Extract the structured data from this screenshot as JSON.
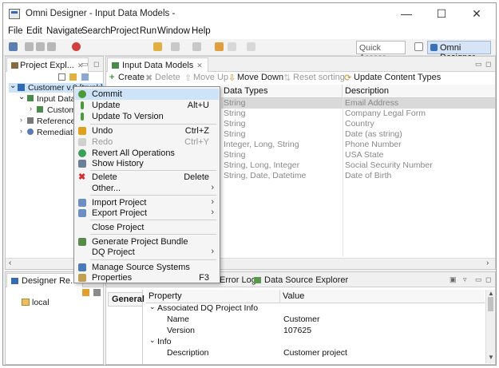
{
  "window": {
    "title": "Omni Designer - Input Data Models -",
    "minimize": "—",
    "maximize": "☐",
    "close": "✕"
  },
  "menubar": [
    "File",
    "Edit",
    "Navigate",
    "Search",
    "Project",
    "Run",
    "Window",
    "Help"
  ],
  "toolbar": {
    "quick_access": "Quick Access",
    "perspective": "Omni Designer"
  },
  "project_explorer": {
    "tab": "Project Expl...",
    "tree": [
      {
        "label": "Customer v.0 [trunk]",
        "level": 0
      },
      {
        "label": "Input Data",
        "level": 1
      },
      {
        "label": "Custom",
        "level": 2
      },
      {
        "label": "Reference",
        "level": 1
      },
      {
        "label": "Remediati",
        "level": 1
      }
    ]
  },
  "designer_repo": {
    "tab": "Designer Re...",
    "item": "local"
  },
  "editor": {
    "tab": "Input Data Models",
    "actions": {
      "create": "Create",
      "delete": "Delete",
      "move_up": "Move Up",
      "move_down": "Move Down",
      "reset_sorting": "Reset sorting",
      "update_content_types": "Update Content Types"
    },
    "columns": [
      "Data Types",
      "Description"
    ],
    "rows": [
      [
        "String",
        "Email Address"
      ],
      [
        "String",
        "Company Legal Form"
      ],
      [
        "String",
        "Country"
      ],
      [
        "String",
        "Date (as string)"
      ],
      [
        "Integer, Long, String",
        "Phone Number"
      ],
      [
        "String",
        "USA State"
      ],
      [
        "String, Long, Integer",
        "Social Security Number"
      ],
      [
        "String, Date, Datetime",
        "Date of Birth"
      ]
    ]
  },
  "bottom_panel": {
    "tabs": [
      "Error Log",
      "Data Source Explorer"
    ],
    "side_tab": "General",
    "columns": [
      "Property",
      "Value"
    ],
    "props": [
      {
        "name": "Associated DQ Project Info",
        "value": "",
        "level": 0,
        "group": true
      },
      {
        "name": "Name",
        "value": "Customer",
        "level": 1
      },
      {
        "name": "Version",
        "value": "107625",
        "level": 1
      },
      {
        "name": "Info",
        "value": "",
        "level": 0,
        "group": true
      },
      {
        "name": "Description",
        "value": "Customer project",
        "level": 1
      }
    ]
  },
  "context_menu": {
    "items": [
      {
        "label": "Commit",
        "shortcut": "",
        "highlight": true,
        "color": "#4a9a3a"
      },
      {
        "label": "Update",
        "shortcut": "Alt+U",
        "color": "#4a9a3a"
      },
      {
        "label": "Update To Version",
        "shortcut": "",
        "color": "#4a9a3a"
      },
      {
        "label": "Undo",
        "shortcut": "Ctrl+Z",
        "color": "#e0a020"
      },
      {
        "label": "Redo",
        "shortcut": "Ctrl+Y",
        "disabled": true,
        "color": "#c8c8c8"
      },
      {
        "label": "Revert All Operations",
        "shortcut": "",
        "color": "#3aa05a"
      },
      {
        "label": "Show History",
        "shortcut": "",
        "color": "#6a7f9a"
      },
      {
        "label": "Delete",
        "shortcut": "Delete",
        "color": "#d03030"
      },
      {
        "label": "Other...",
        "shortcut": "",
        "submenu": true,
        "color": "#ffffff"
      },
      {
        "label": "Import Project",
        "shortcut": "",
        "submenu": true,
        "color": "#6a8fc0"
      },
      {
        "label": "Export Project",
        "shortcut": "",
        "submenu": true,
        "color": "#6a8fc0"
      },
      {
        "label": "Close Project",
        "shortcut": "",
        "color": "#ffffff"
      },
      {
        "label": "Generate Project Bundle",
        "shortcut": "",
        "color": "#5a8a4a"
      },
      {
        "label": "DQ Project",
        "shortcut": "",
        "submenu": true,
        "color": "#ffffff"
      },
      {
        "label": "Manage Source Systems",
        "shortcut": "",
        "color": "#4a7ab8"
      },
      {
        "label": "Properties",
        "shortcut": "F3",
        "color": "#c0a050"
      }
    ]
  }
}
